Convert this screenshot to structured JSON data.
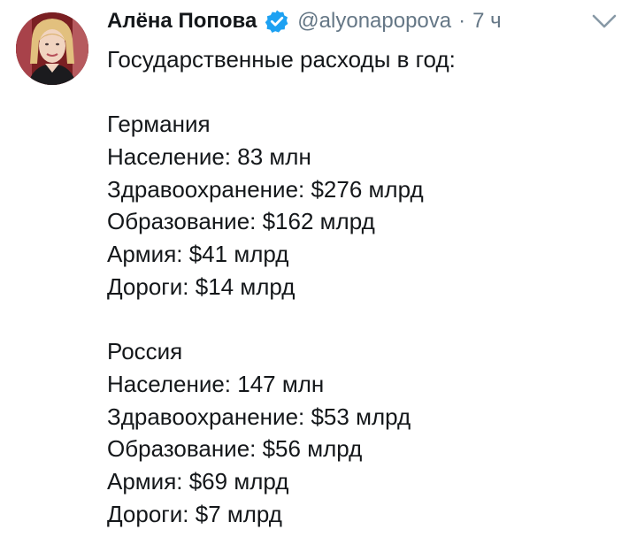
{
  "tweet": {
    "author": {
      "name": "Алёна Попова",
      "handle": "@alyonapopova",
      "avatar_icon": "user-avatar-photo",
      "verified_icon": "verified-badge-icon"
    },
    "separator": "·",
    "time": "7 ч",
    "menu_icon": "chevron-down-icon",
    "text": {
      "intro": "Государственные расходы в год:",
      "countries": [
        {
          "country": "Германия",
          "population": "Население: 83 млн",
          "healthcare": "Здравоохранение: $276 млрд",
          "education": "Образование: $162 млрд",
          "army": "Армия: $41 млрд",
          "roads": "Дороги: $14 млрд"
        },
        {
          "country": "Россия",
          "population": "Население: 147 млн",
          "healthcare": "Здравоохранение: $53 млрд",
          "education": "Образование: $56 млрд",
          "army": "Армия: $69 млрд",
          "roads": "Дороги: $7 млрд"
        }
      ]
    }
  },
  "colors": {
    "text": "#14171a",
    "secondary": "#657786",
    "verified": "#1da1f2",
    "background": "#ffffff"
  }
}
